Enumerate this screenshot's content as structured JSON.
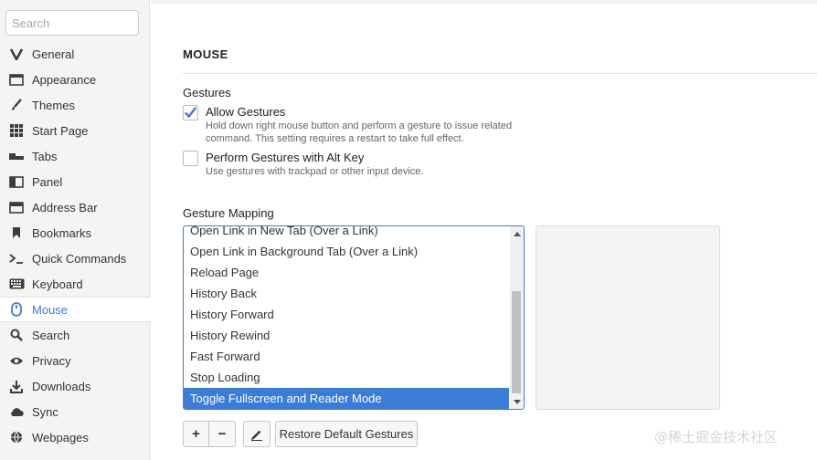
{
  "sidebar": {
    "search_placeholder": "Search",
    "items": [
      {
        "label": "General",
        "icon": "vivaldi-v-icon",
        "active": false
      },
      {
        "label": "Appearance",
        "icon": "window-icon",
        "active": false
      },
      {
        "label": "Themes",
        "icon": "brush-icon",
        "active": false
      },
      {
        "label": "Start Page",
        "icon": "grid-icon",
        "active": false
      },
      {
        "label": "Tabs",
        "icon": "tabs-icon",
        "active": false
      },
      {
        "label": "Panel",
        "icon": "panel-icon",
        "active": false
      },
      {
        "label": "Address Bar",
        "icon": "address-bar-icon",
        "active": false
      },
      {
        "label": "Bookmarks",
        "icon": "bookmark-icon",
        "active": false
      },
      {
        "label": "Quick Commands",
        "icon": "command-icon",
        "active": false
      },
      {
        "label": "Keyboard",
        "icon": "keyboard-icon",
        "active": false
      },
      {
        "label": "Mouse",
        "icon": "mouse-icon",
        "active": true
      },
      {
        "label": "Search",
        "icon": "search-icon",
        "active": false
      },
      {
        "label": "Privacy",
        "icon": "eye-icon",
        "active": false
      },
      {
        "label": "Downloads",
        "icon": "download-icon",
        "active": false
      },
      {
        "label": "Sync",
        "icon": "cloud-icon",
        "active": false
      },
      {
        "label": "Webpages",
        "icon": "globe-icon",
        "active": false
      }
    ]
  },
  "main": {
    "section_title": "MOUSE",
    "gestures": {
      "title": "Gestures",
      "allow": {
        "label": "Allow Gestures",
        "checked": true,
        "description_line1": "Hold down right mouse button and perform a gesture to issue related",
        "description_line2": "command. This setting requires a restart to take full effect."
      },
      "alt_key": {
        "label": "Perform Gestures with Alt Key",
        "checked": false,
        "description": "Use gestures with trackpad or other input device."
      }
    },
    "mapping": {
      "title": "Gesture Mapping",
      "items": [
        {
          "label": "Open Link in New Tab (Over a Link)",
          "selected": false
        },
        {
          "label": "Open Link in Background Tab (Over a Link)",
          "selected": false
        },
        {
          "label": "Reload Page",
          "selected": false
        },
        {
          "label": "History Back",
          "selected": false
        },
        {
          "label": "History Forward",
          "selected": false
        },
        {
          "label": "History Rewind",
          "selected": false
        },
        {
          "label": "Fast Forward",
          "selected": false
        },
        {
          "label": "Stop Loading",
          "selected": false
        },
        {
          "label": "Toggle Fullscreen and Reader Mode",
          "selected": true
        }
      ]
    },
    "buttons": {
      "add": "+",
      "remove": "−",
      "restore": "Restore Default Gestures"
    },
    "watermark": "@稀土掘金技术社区"
  },
  "colors": {
    "accent": "#3a7dd8",
    "sidebar_bg": "#f4f4f4",
    "text": "#333333"
  }
}
